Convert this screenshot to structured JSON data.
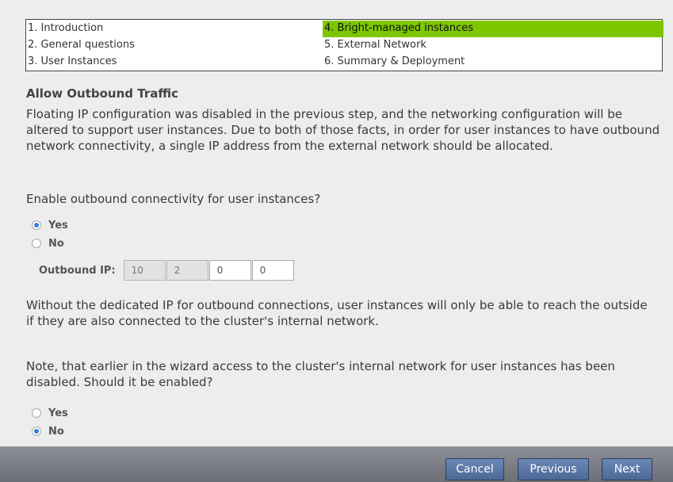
{
  "steps": [
    {
      "label": "1. Introduction",
      "active": false
    },
    {
      "label": "4. Bright-managed instances",
      "active": true
    },
    {
      "label": "2. General questions",
      "active": false
    },
    {
      "label": "5. External Network",
      "active": false
    },
    {
      "label": "3. User Instances",
      "active": false
    },
    {
      "label": "6. Summary & Deployment",
      "active": false
    }
  ],
  "colors": {
    "active_step": "#7dc600",
    "button": "#5a77a8",
    "footer": "#7b7e85"
  },
  "section": {
    "heading": "Allow Outbound Traffic",
    "intro": "Floating IP configuration was disabled in the previous step, and the networking configuration will be altered to support user instances. Due to both of those facts, in order for user instances to have outbound network connectivity, a single IP address from the external network should be allocated.",
    "question1": "Enable outbound connectivity for user instances?",
    "q1_yes": "Yes",
    "q1_no": "No",
    "q1_selected": "Yes",
    "outbound_ip_label": "Outbound IP:",
    "outbound_ip": [
      "10",
      "2",
      "0",
      "0"
    ],
    "warning": "Without the dedicated IP for outbound connections, user instances will only be able to reach the outside if they are also connected to the cluster's internal network.",
    "question2": "Note, that earlier in the wizard access to the cluster's internal network for user instances has been disabled. Should it be enabled?",
    "q2_yes": "Yes",
    "q2_no": "No",
    "q2_selected": "No"
  },
  "footer": {
    "cancel": "Cancel",
    "previous": "Previous",
    "next": "Next"
  }
}
